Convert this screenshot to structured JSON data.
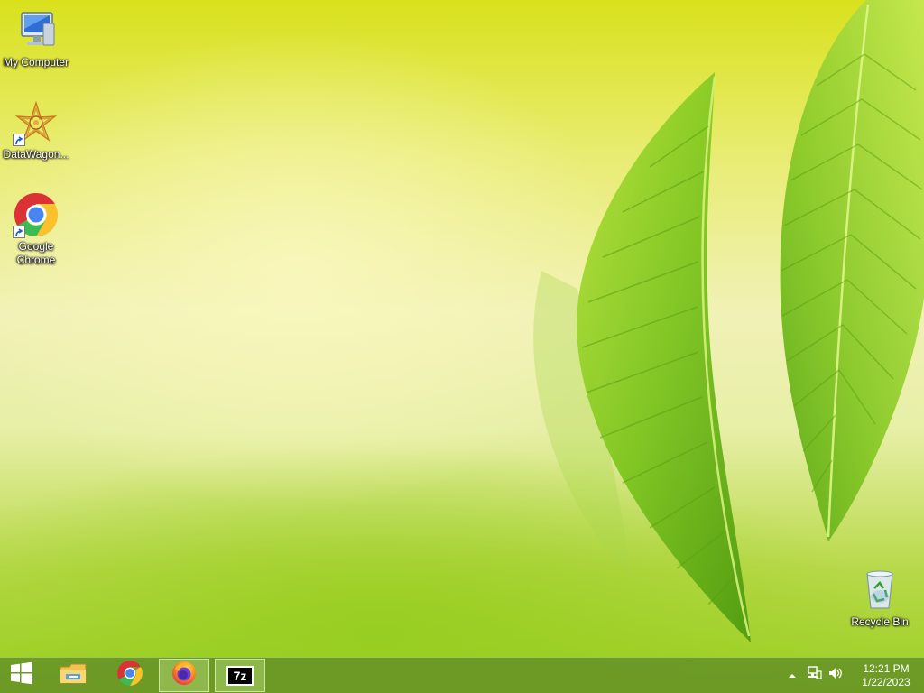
{
  "desktop": {
    "icons": [
      {
        "label": "My Computer",
        "icon": "computer-icon"
      },
      {
        "label": "DataWagon...",
        "icon": "datawagon-icon"
      },
      {
        "label": "Google Chrome",
        "icon": "chrome-icon"
      },
      {
        "label": "Recycle Bin",
        "icon": "recycle-bin-icon"
      }
    ]
  },
  "taskbar": {
    "start": {
      "icon": "windows-logo-icon"
    },
    "pinned": [
      {
        "name": "File Explorer",
        "icon": "file-explorer-icon",
        "active": false
      },
      {
        "name": "Google Chrome",
        "icon": "chrome-icon",
        "active": false
      },
      {
        "name": "Firefox",
        "icon": "firefox-icon",
        "active": true
      },
      {
        "name": "7-Zip",
        "icon": "7zip-icon",
        "active": true,
        "text": "7z"
      }
    ],
    "tray": {
      "icons": [
        "show-hidden-icons-chevron",
        "network-icon",
        "volume-icon"
      ],
      "time": "12:21 PM",
      "date": "1/22/2023"
    }
  },
  "colors": {
    "taskbar": "#689626",
    "wallpaper_top": "#d9e11c",
    "wallpaper_bottom": "#9ccf22",
    "leaf": "#7cc41e"
  }
}
